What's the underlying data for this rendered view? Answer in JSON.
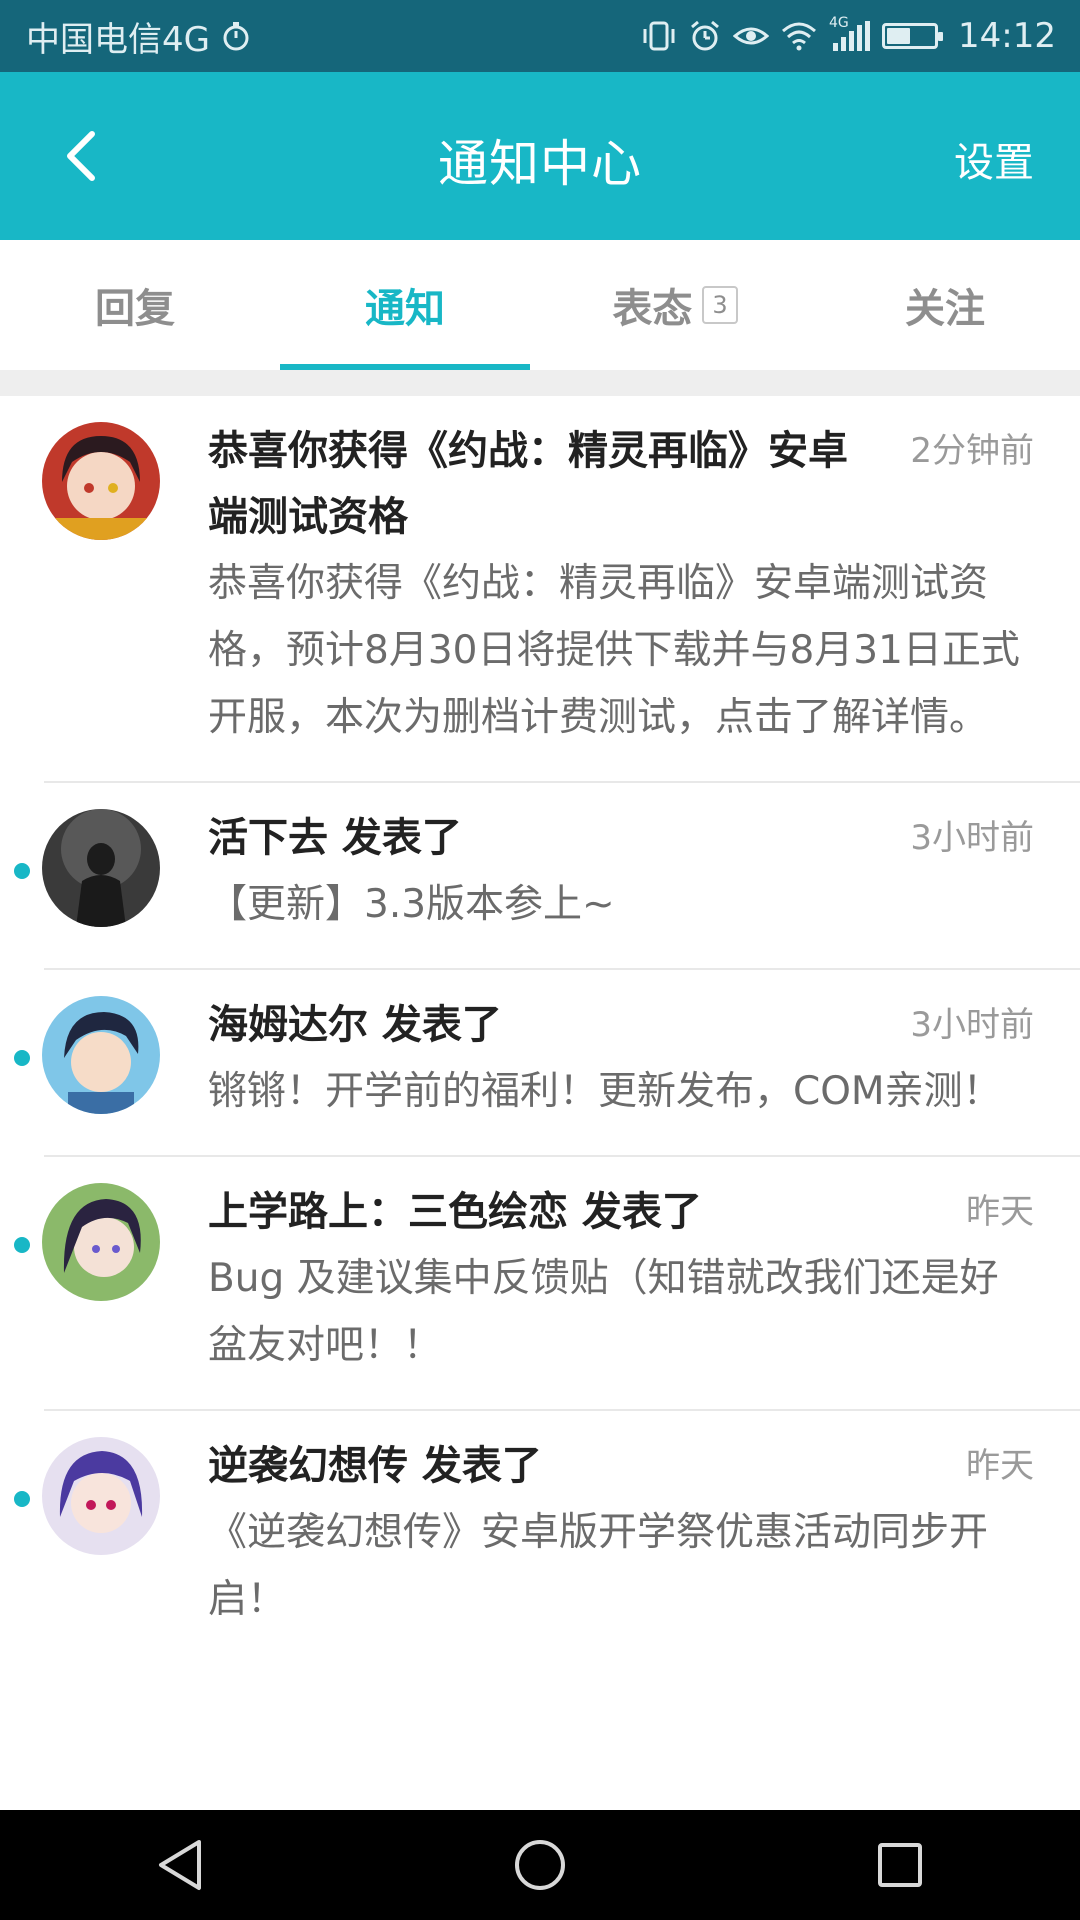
{
  "status_bar": {
    "carrier": "中国电信4G",
    "time": "14:12",
    "battery_level": 0.5,
    "network": "4G"
  },
  "header": {
    "title": "通知中心",
    "settings_label": "设置"
  },
  "tabs": [
    {
      "label": "回复",
      "active": false
    },
    {
      "label": "通知",
      "active": true
    },
    {
      "label": "表态",
      "badge": "3",
      "active": false
    },
    {
      "label": "关注",
      "active": false
    }
  ],
  "notifications": [
    {
      "title": "恭喜你获得《约战：精灵再临》安卓端测试资格",
      "time": "2分钟前",
      "body": "恭喜你获得《约战：精灵再临》安卓端测试资格，预计8月30日将提供下载并与8月31日正式开服，本次为删档计费测试，点击了解详情。",
      "unread": false
    },
    {
      "title": "活下去 发表了",
      "time": "3小时前",
      "body": "【更新】3.3版本参上~",
      "unread": true
    },
    {
      "title": "海姆达尔 发表了",
      "time": "3小时前",
      "body": "锵锵！开学前的福利！更新发布，COM亲测！",
      "unread": true
    },
    {
      "title": "上学路上：三色绘恋 发表了",
      "time": "昨天",
      "body": "Bug 及建议集中反馈贴（知错就改我们还是好盆友对吧！！",
      "unread": true
    },
    {
      "title": "逆袭幻想传 发表了",
      "time": "昨天",
      "body": "《逆袭幻想传》安卓版开学祭优惠活动同步开启！",
      "unread": true
    }
  ],
  "colors": {
    "accent": "#18b7c6",
    "status_bar": "#15667a",
    "unread_dot": "#18b7c6"
  }
}
